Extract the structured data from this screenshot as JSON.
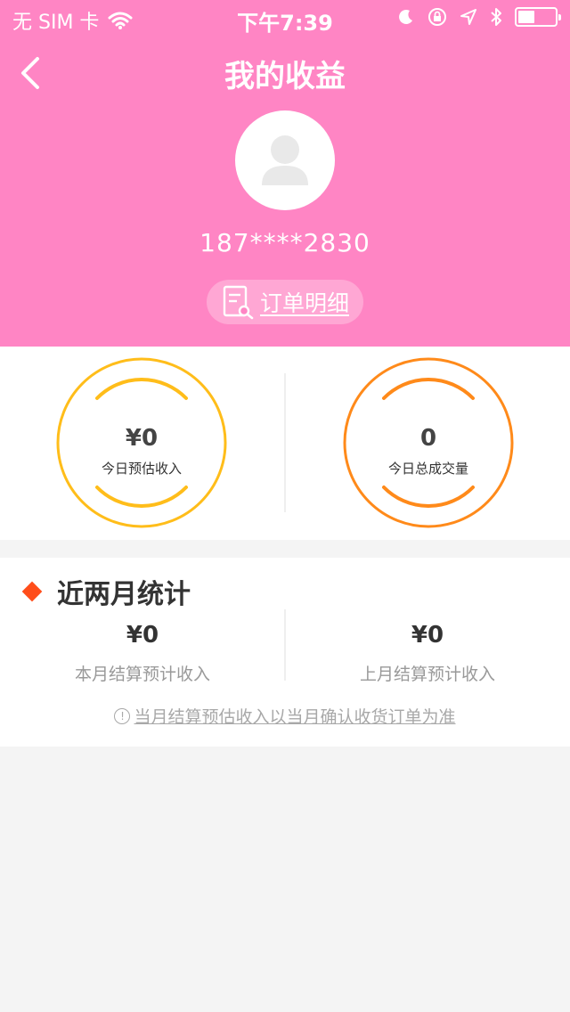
{
  "status_bar": {
    "carrier": "无 SIM 卡",
    "time": "下午7:39"
  },
  "nav": {
    "title": "我的收益"
  },
  "profile": {
    "phone": "187****2830",
    "order_button": "订单明细"
  },
  "today": {
    "income_value": "¥0",
    "income_label": "今日预估收入",
    "volume_value": "0",
    "volume_label": "今日总成交量",
    "income_ring_color": "#ffbd1a",
    "volume_ring_color": "#ff8a1a"
  },
  "stats": {
    "title": "近两月统计",
    "this_month_value": "¥0",
    "this_month_label": "本月结算预计收入",
    "last_month_value": "¥0",
    "last_month_label": "上月结算预计收入",
    "note": "当月结算预估收入以当月确认收货订单为准",
    "note_icon": "!"
  }
}
